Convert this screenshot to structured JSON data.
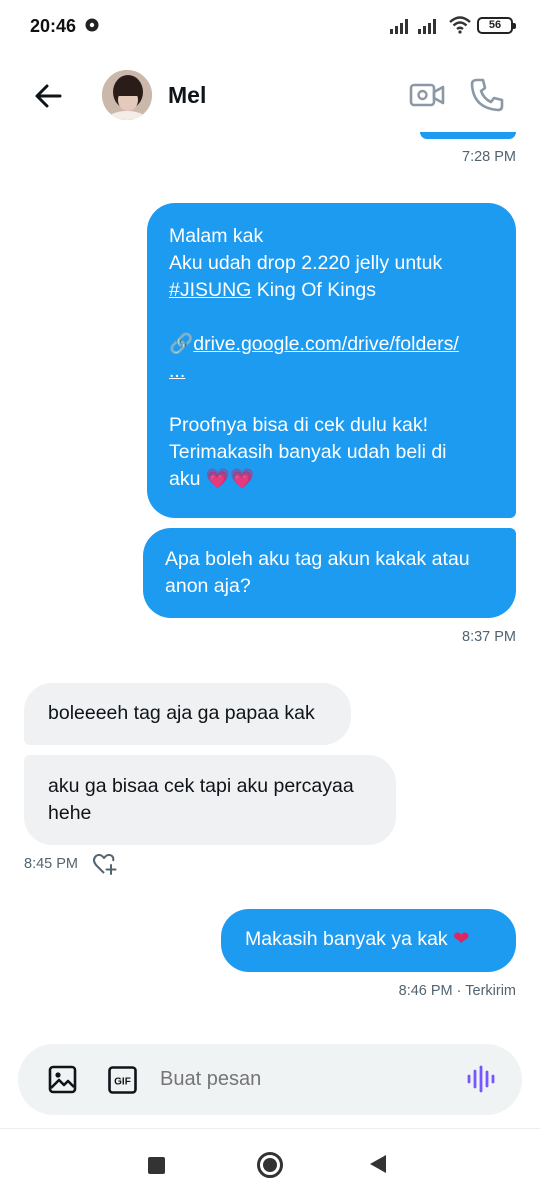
{
  "status_bar": {
    "time": "20:46",
    "battery": "56"
  },
  "header": {
    "name": "Mel"
  },
  "messages": {
    "m1_lines": [
      "Malam kak",
      "Aku udah drop 2.220 jelly untuk",
      "#JISUNG",
      " King Of Kings",
      "drive.google.com/drive/folders/",
      "...",
      "Proofnya bisa di cek dulu kak!",
      "Terimakasih banyak udah beli di",
      "aku 💗💗"
    ],
    "m1_link_icon": "🔗",
    "m2_lines": [
      "Apa boleh aku tag akun kakak atau",
      "anon aja?"
    ],
    "time_1": "7:28 PM",
    "time_2": "8:37 PM",
    "m3": "boleeeeh tag aja ga papaa kak",
    "m4_lines": [
      "aku ga bisaa cek tapi aku percayaa",
      "hehe"
    ],
    "time_3": "8:45 PM",
    "m5": "Makasih banyak ya kak",
    "m5_emoji": "❤",
    "time_4": "8:46 PM · Terkirim"
  },
  "compose": {
    "placeholder": "Buat pesan"
  },
  "colors": {
    "accent": "#1d9bf0",
    "incoming": "#eff1f3",
    "voice": "#7856ff"
  }
}
